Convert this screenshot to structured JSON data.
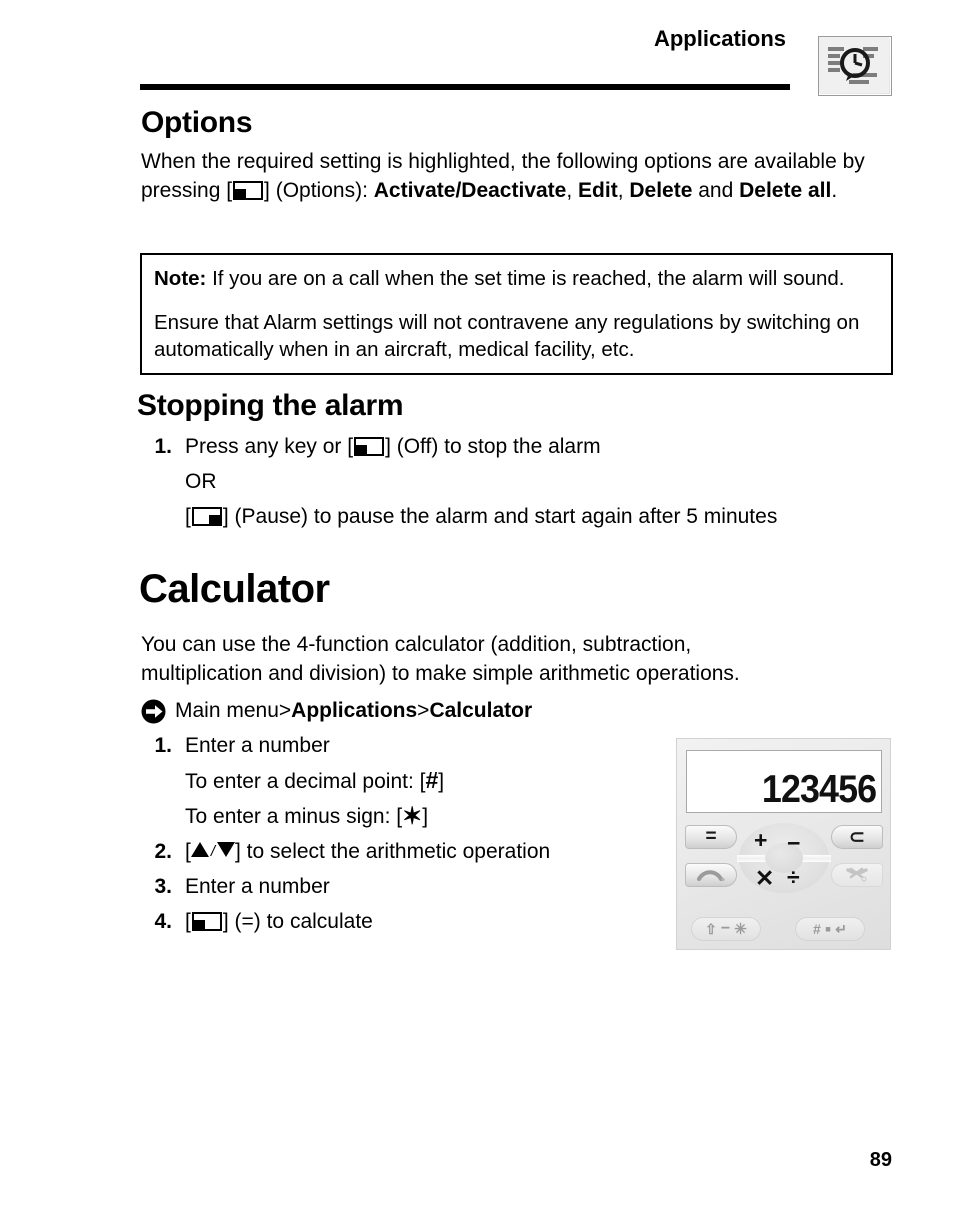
{
  "header": {
    "title": "Applications",
    "icon": "applications-clock-icon"
  },
  "sections": {
    "options": {
      "heading": "Options",
      "body_prefix": "When the required setting is highlighted, the following options are available by pressing [",
      "body_mid": "] (Options): ",
      "opt1": "Activate/Deactivate",
      "sep1": ", ",
      "opt2": "Edit",
      "sep2": ", ",
      "opt3": "Delete",
      "sep3": " and ",
      "opt4": "Delete all",
      "sep4": "."
    },
    "note": {
      "label": "Note:",
      "line1": " If you are on a call when the set time is reached, the alarm will sound.",
      "line2": "Ensure that Alarm settings will not contravene any regulations by switching on automatically when in an aircraft, medical facility, etc."
    },
    "stopping": {
      "heading": "Stopping the alarm",
      "step1_num": "1.",
      "step1_a": "Press any key or [",
      "step1_b": "] (Off) to stop the alarm",
      "step1_or": "OR",
      "step1_pause_a": "[",
      "step1_pause_b": "] (Pause) to pause the alarm and start again after 5 minutes"
    },
    "calculator": {
      "heading": "Calculator",
      "intro_line1": "You can use the 4-function calculator (addition, subtraction,",
      "intro_line2": "multiplication and division) to make simple arithmetic operations.",
      "breadcrumb": {
        "icon": "nav-arrow-icon",
        "root": "Main menu",
        "sep1": " > ",
        "level1": "Applications",
        "sep2": " > ",
        "level2": "Calculator"
      },
      "steps": [
        {
          "num": "1.",
          "text": "Enter a number"
        },
        {
          "num": "",
          "text_a": "To enter a decimal point: [",
          "glyph": "#",
          "text_b": "]"
        },
        {
          "num": "",
          "text_a": "To enter a minus sign: [",
          "glyph": "✶",
          "text_b": "]"
        },
        {
          "num": "2.",
          "text_a": "[",
          "text_b": "] to select the arithmetic operation"
        },
        {
          "num": "3.",
          "text": "Enter a number"
        },
        {
          "num": "4.",
          "text_a": "[",
          "text_b": "] (=) to calculate"
        }
      ]
    }
  },
  "calculator_figure": {
    "display_value": "123456",
    "keys": {
      "equals": "=",
      "clear": "⊂",
      "call": "call-key",
      "end": "end-key",
      "left_bottom": "shift-minus-star-key",
      "right_bottom": "hash-dot-key"
    },
    "operators": {
      "plus": "+",
      "minus": "−",
      "multiply": "✕",
      "divide": "÷"
    }
  },
  "footer": {
    "page_number": "89"
  }
}
